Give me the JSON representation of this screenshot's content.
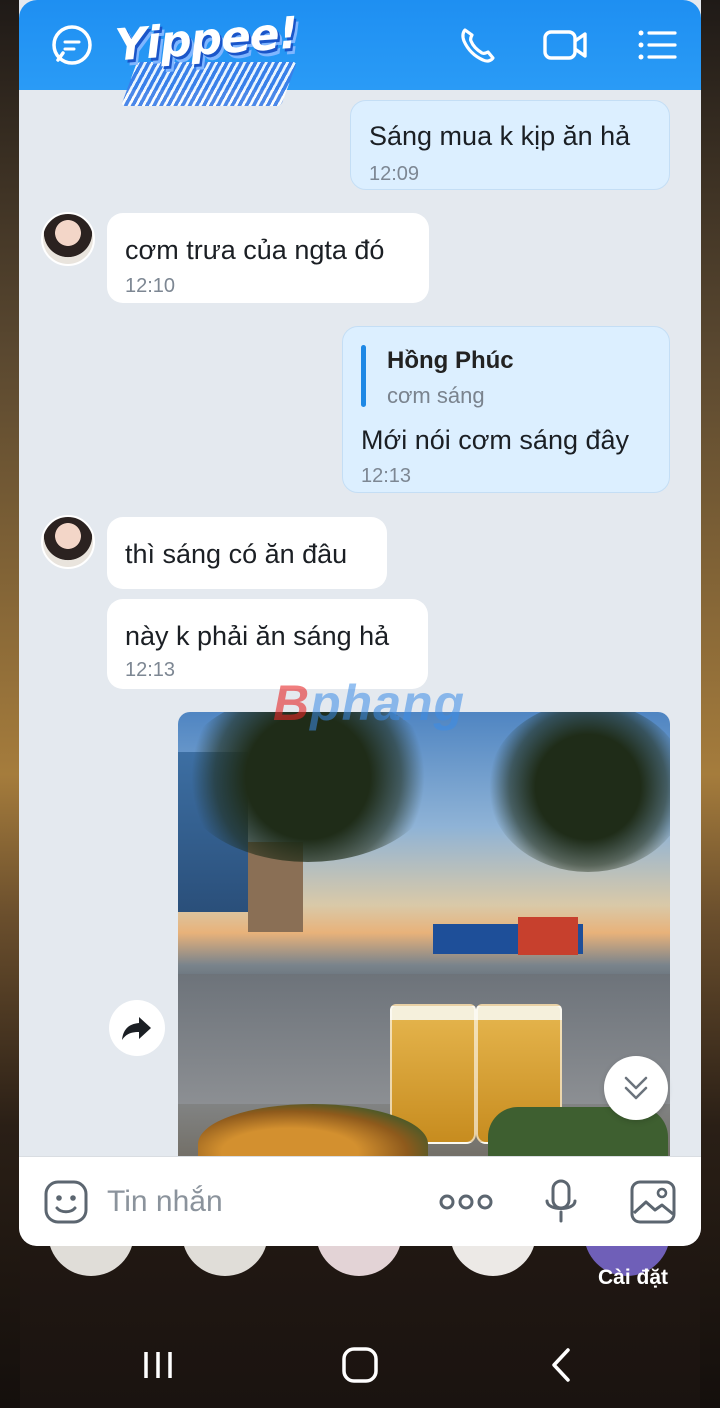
{
  "app": {
    "logo_text": "Yippee!",
    "theme_color": "#1e8ff2",
    "header_icons": [
      "chat-icon",
      "phone-icon",
      "video-call-icon",
      "menu-list-icon"
    ]
  },
  "messages": [
    {
      "direction": "outgoing",
      "text": "Sáng mua k kịp ăn hả",
      "time": "12:09"
    },
    {
      "direction": "incoming",
      "text": "cơm trưa của ngta đó",
      "time": "12:10"
    },
    {
      "direction": "outgoing",
      "reply_to": {
        "name": "Hồng Phúc",
        "text": "cơm sáng"
      },
      "text": "Mới nói cơm sáng đây",
      "time": "12:13"
    },
    {
      "direction": "incoming",
      "text": "thì sáng có ăn đâu",
      "time": ""
    },
    {
      "direction": "incoming",
      "text": "này k phải ăn sáng hả",
      "time": "12:13"
    },
    {
      "direction": "outgoing",
      "type": "photo",
      "description_icon": "photo"
    }
  ],
  "watermark": {
    "prefix": "B",
    "rest": "phang"
  },
  "composer": {
    "placeholder": "Tin nhắn",
    "icons": [
      "sticker-icon",
      "more-dots-icon",
      "microphone-icon",
      "gallery-icon"
    ]
  },
  "home_dock": {
    "label": "Cài đặt"
  },
  "system_nav": [
    "recent-apps-icon",
    "home-icon",
    "back-icon"
  ]
}
